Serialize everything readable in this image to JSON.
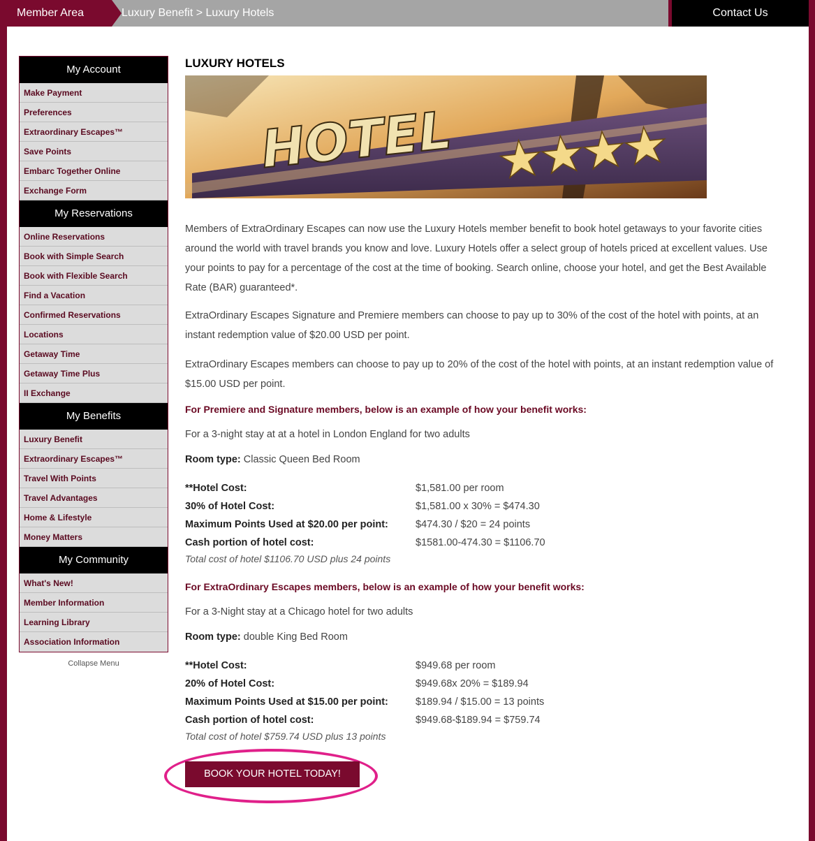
{
  "topbar": {
    "member_area": "Member Area",
    "breadcrumb": "Luxury Benefit > Luxury Hotels",
    "contact": "Contact Us"
  },
  "sidebar": {
    "sections": [
      {
        "heading": "My Account",
        "items": [
          "Make Payment",
          "Preferences",
          "Extraordinary Escapes™",
          "Save Points",
          "Embarc Together Online",
          "Exchange Form"
        ]
      },
      {
        "heading": "My Reservations",
        "items": [
          "Online Reservations",
          "Book with Simple Search",
          "Book with Flexible Search",
          "Find a Vacation",
          "Confirmed Reservations",
          "Locations",
          "Getaway Time",
          "Getaway Time Plus",
          "II Exchange"
        ]
      },
      {
        "heading": "My Benefits",
        "items": [
          "Luxury Benefit",
          "Extraordinary Escapes™",
          "Travel With Points",
          "Travel Advantages",
          "Home & Lifestyle",
          "Money Matters"
        ]
      },
      {
        "heading": "My Community",
        "items": [
          "What's New!",
          "Member Information",
          "Learning Library",
          "Association Information"
        ]
      }
    ],
    "collapse": "Collapse Menu"
  },
  "main": {
    "title": "LUXURY HOTELS",
    "hero_text": "HOTEL",
    "para1": "Members of ExtraOrdinary Escapes can now use the Luxury Hotels member benefit to book hotel getaways to your favorite cities around the world with travel brands you know and love. Luxury Hotels offer a select group of hotels priced at excellent values. Use your points to pay for a percentage of the cost at the time of booking. Search online, choose your hotel, and get the Best Available Rate (BAR) guaranteed*.",
    "para2": "ExtraOrdinary Escapes Signature and Premiere members can choose to pay up to 30% of the cost of the hotel with points, at an instant redemption value of $20.00 USD per point.",
    "para3": "ExtraOrdinary Escapes members can choose to pay up to 20% of the cost of the hotel with points, at an instant redemption value of $15.00 USD per point.",
    "example1": {
      "heading": "For Premiere and Signature members, below is an example of how your benefit works:",
      "stay": "For a 3-night stay at at a hotel in London England for two adults",
      "room_label": "Room type:",
      "room_value": " Classic Queen Bed Room",
      "rows": [
        {
          "label": "**Hotel Cost:",
          "value": "$1,581.00 per room"
        },
        {
          "label": "30% of Hotel Cost:",
          "value": "$1,581.00 x 30% = $474.30"
        },
        {
          "label": "Maximum Points Used at $20.00 per point:",
          "value": "$474.30 / $20 = 24 points"
        },
        {
          "label": "Cash portion of hotel cost:",
          "value": "$1581.00-474.30 = $1106.70"
        }
      ],
      "total": "Total cost of hotel $1106.70 USD plus 24 points"
    },
    "example2": {
      "heading": "For ExtraOrdinary Escapes members, below is an example of how your benefit works:",
      "stay": "For a 3-Night stay at a Chicago hotel for two adults",
      "room_label": "Room type:",
      "room_value": " double King Bed Room",
      "rows": [
        {
          "label": "**Hotel Cost:",
          "value": "$949.68 per room"
        },
        {
          "label": "20% of Hotel Cost:",
          "value": "$949.68x 20% = $189.94"
        },
        {
          "label": "Maximum Points Used at $15.00 per point:",
          "value": "$189.94 / $15.00 = 13 points"
        },
        {
          "label": "Cash portion of hotel cost:",
          "value": "$949.68-$189.94 = $759.74"
        }
      ],
      "total": "Total cost of hotel $759.74 USD plus 13 points"
    },
    "book_button": "BOOK YOUR HOTEL TODAY!"
  }
}
